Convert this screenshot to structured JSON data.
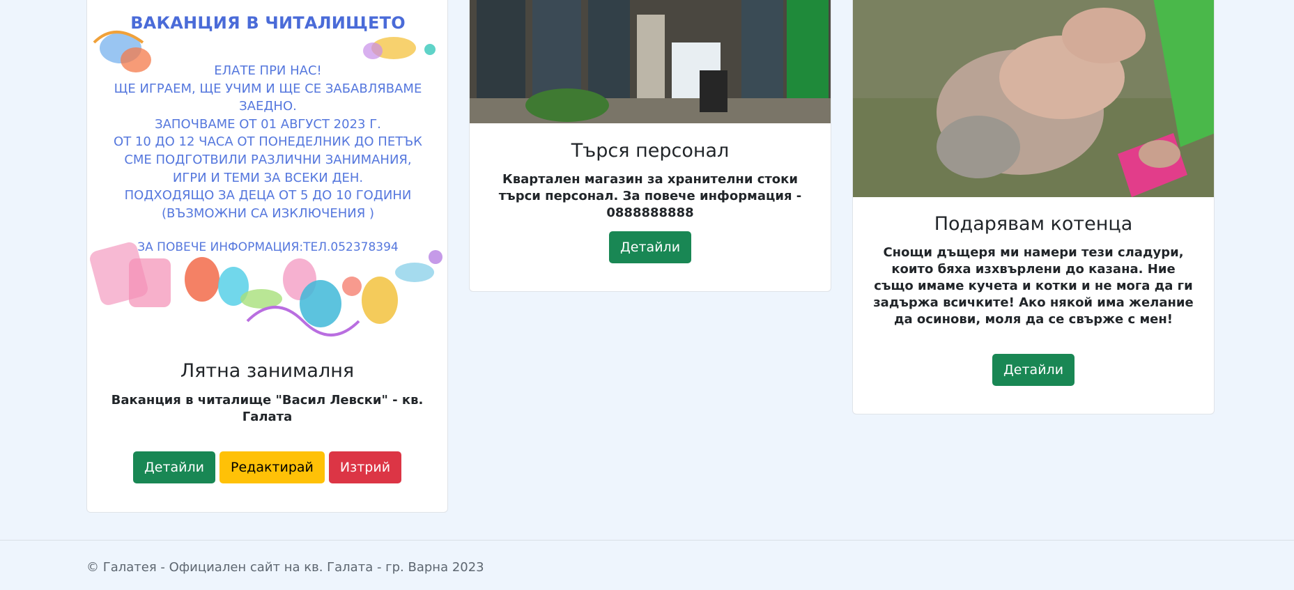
{
  "cards": [
    {
      "poster": {
        "title": "ВАКАНЦИЯ В ЧИТАЛИЩЕТО",
        "body_lines": [
          "ЕЛАТЕ ПРИ НАС!",
          "ЩЕ ИГРАЕМ, ЩЕ УЧИМ И ЩЕ СЕ ЗАБАВЛЯВАМЕ",
          "ЗАЕДНО.",
          "ЗАПОЧВАМЕ ОТ 01 АВГУСТ 2023 Г.",
          "ОТ 10 ДО 12 ЧАСА ОТ ПОНЕДЕЛНИК ДО ПЕТЪК",
          "СМЕ ПОДГОТВИЛИ РАЗЛИЧНИ ЗАНИМАНИЯ,",
          "ИГРИ И ТЕМИ ЗА ВСЕКИ ДЕН.",
          "ПОДХОДЯЩО ЗА ДЕЦА ОТ 5 ДО 10 ГОДИНИ",
          "(ВЪЗМОЖНИ СА ИЗКЛЮЧЕНИЯ )"
        ],
        "contact": "ЗА ПОВЕЧЕ ИНФОРМАЦИЯ:ТЕЛ.052378394"
      },
      "title": "Лятна занималня",
      "text": "Ваканция в читалище \"Васил Левски\" - кв. Галата",
      "buttons": {
        "details": "Детайли",
        "edit": "Редактирай",
        "delete": "Изтрий"
      }
    },
    {
      "title": "Търся персонал",
      "text": "Квартален магазин за хранителни стоки търси персонал. За повече информация - 0888888888",
      "buttons": {
        "details": "Детайли"
      }
    },
    {
      "title": "Подарявам котенца",
      "text": "Снощи дъщеря ми намери тези сладури, които бяха изхвърлени до казана. Ние също имаме кучета и котки и не мога да ги задържа всичките! Ако някой има желание да осинови, моля да се свърже с мен!",
      "buttons": {
        "details": "Детайли"
      }
    }
  ],
  "footer": {
    "text": "© Галатея - Официален сайт на кв. Галата - гр. Варна 2023"
  },
  "colors": {
    "success": "#198754",
    "warning": "#ffc107",
    "danger": "#dc3545",
    "background": "#eef5fd"
  }
}
